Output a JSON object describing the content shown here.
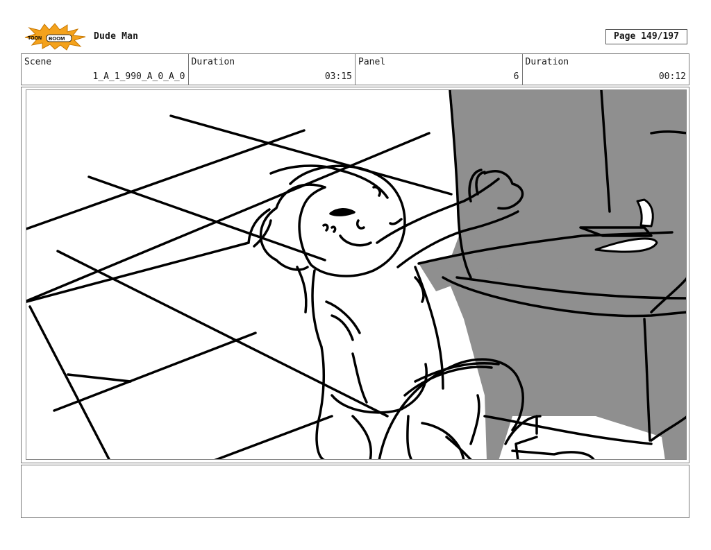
{
  "header": {
    "logo_text": "TOON BOOM",
    "project_title": "Dude Man",
    "page": "Page 149/197"
  },
  "info_bar": [
    {
      "label": "Scene",
      "value": "1_A_1_990_A_0_A_0"
    },
    {
      "label": "Duration",
      "value": "03:15"
    },
    {
      "label": "Panel",
      "value": "6"
    },
    {
      "label": "Duration",
      "value": "00:12"
    }
  ],
  "notes": {
    "text": ""
  },
  "colors": {
    "sketch_gray": "#8f8f8f",
    "ink": "#000000",
    "logo_orange": "#f4a21c"
  }
}
